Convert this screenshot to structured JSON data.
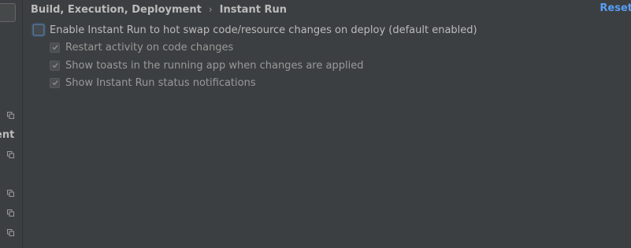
{
  "sidebar": {
    "partial_label": "ent",
    "copy_icons": [
      "copy-icon",
      "copy-icon",
      "copy-icon",
      "copy-icon",
      "copy-icon"
    ]
  },
  "header": {
    "breadcrumb_parent": "Build, Execution, Deployment",
    "breadcrumb_separator": "›",
    "breadcrumb_current": "Instant Run",
    "reset_label": "Reset"
  },
  "settings": {
    "enable_instant_run": {
      "label": "Enable Instant Run to hot swap code/resource changes on deploy (default enabled)",
      "checked": false,
      "focused": true
    },
    "sub_options": [
      {
        "label": "Restart activity on code changes",
        "checked": true,
        "enabled": false
      },
      {
        "label": "Show toasts in the running app when changes are applied",
        "checked": true,
        "enabled": false
      },
      {
        "label": "Show Instant Run status notifications",
        "checked": true,
        "enabled": false
      }
    ]
  },
  "colors": {
    "background": "#3c3f41",
    "text": "#bbbbbb",
    "disabled_text": "#999999",
    "link": "#589df6",
    "focus_ring": "#3d6185"
  }
}
